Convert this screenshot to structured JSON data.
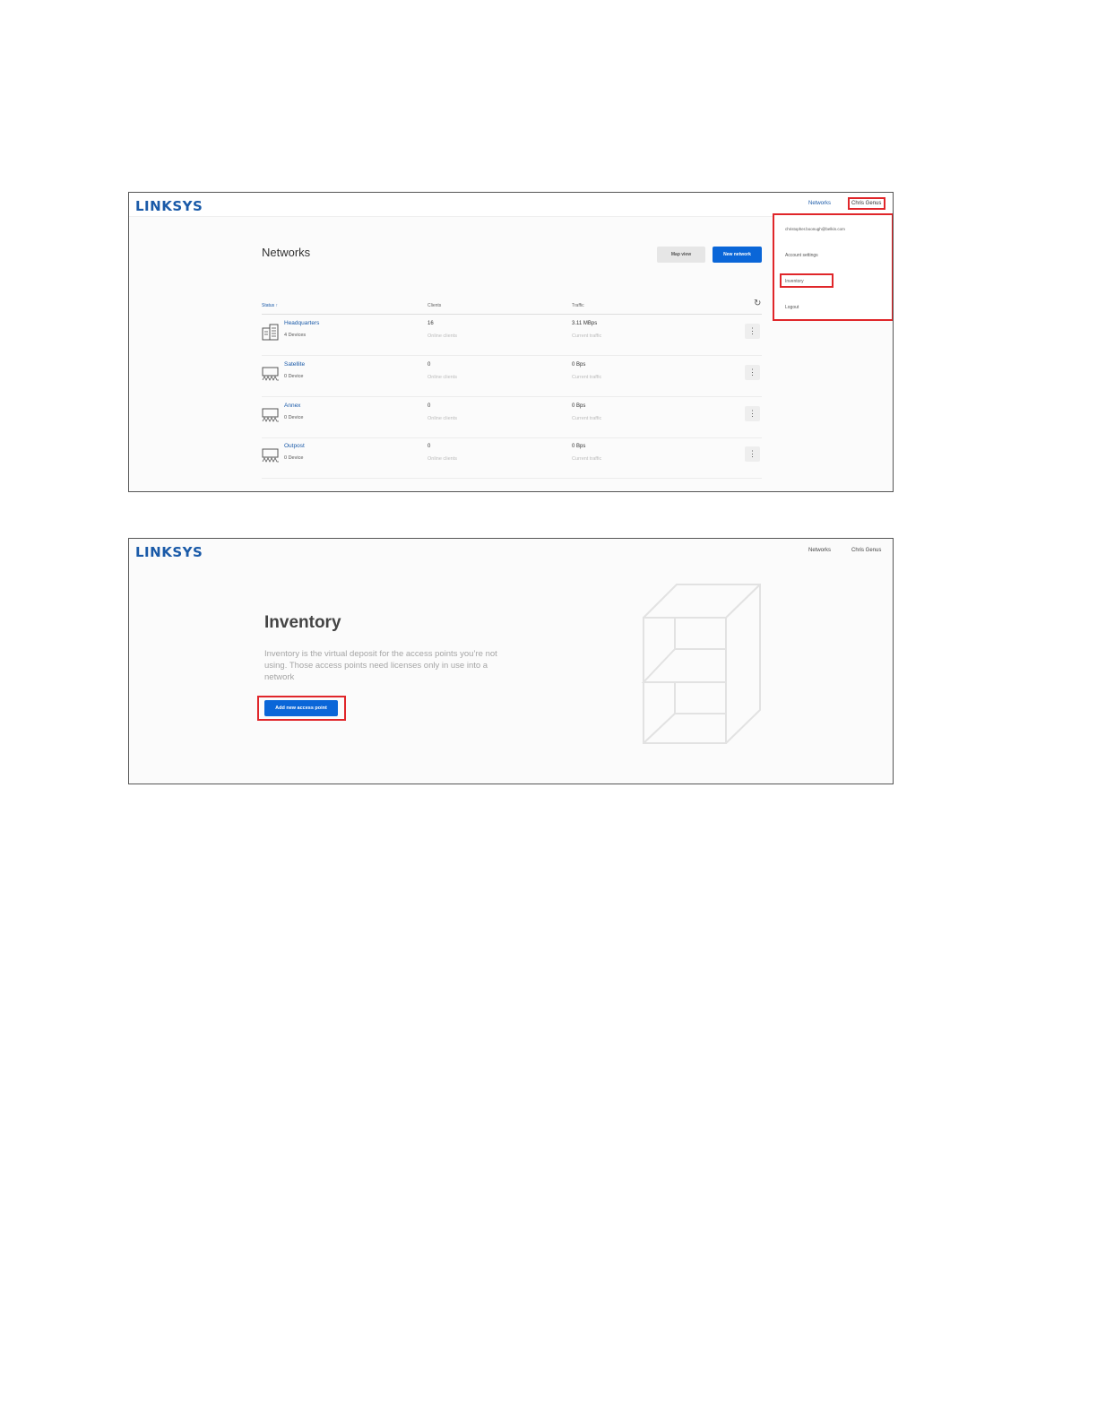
{
  "screenshot1": {
    "logo": "LINKSYS",
    "nav": {
      "networks": "Networks",
      "user": "Chris Genus"
    },
    "page_title": "Networks",
    "buttons": {
      "map_view": "Map view",
      "new_network": "New network"
    },
    "columns": {
      "status": "Status ↑",
      "clients": "Clients",
      "traffic": "Traffic"
    },
    "refresh_icon": "refresh-icon",
    "rows": [
      {
        "name": "Headquarters",
        "devices": "4 Devices",
        "clients": "16",
        "clients_label": "Online clients",
        "traffic": "3.11 MBps",
        "traffic_label": "Current traffic",
        "icon": "building-icon"
      },
      {
        "name": "Satellite",
        "devices": "0 Device",
        "clients": "0",
        "clients_label": "Online clients",
        "traffic": "0 Bps",
        "traffic_label": "Current traffic",
        "icon": "access-point-icon"
      },
      {
        "name": "Annex",
        "devices": "0 Device",
        "clients": "0",
        "clients_label": "Online clients",
        "traffic": "0 Bps",
        "traffic_label": "Current traffic",
        "icon": "access-point-icon"
      },
      {
        "name": "Outpost",
        "devices": "0 Device",
        "clients": "0",
        "clients_label": "Online clients",
        "traffic": "0 Bps",
        "traffic_label": "Current traffic",
        "icon": "access-point-icon"
      }
    ],
    "dropdown": {
      "email": "christopher.boonugh@belkin.com",
      "account_settings": "Account settings",
      "inventory": "Inventory",
      "logout": "Logout"
    }
  },
  "screenshot2": {
    "logo": "LINKSYS",
    "nav": {
      "networks": "Networks",
      "user": "Chris Genus"
    },
    "title": "Inventory",
    "description": "Inventory is the virtual deposit for the access points you’re not using. Those access points need licenses only in use into a network",
    "add_button": "Add new access point",
    "illustration": "shelf-illustration"
  },
  "colors": {
    "brand": "#1a5aa8",
    "primary_button": "#0a66d8",
    "highlight": "#e0262a"
  }
}
